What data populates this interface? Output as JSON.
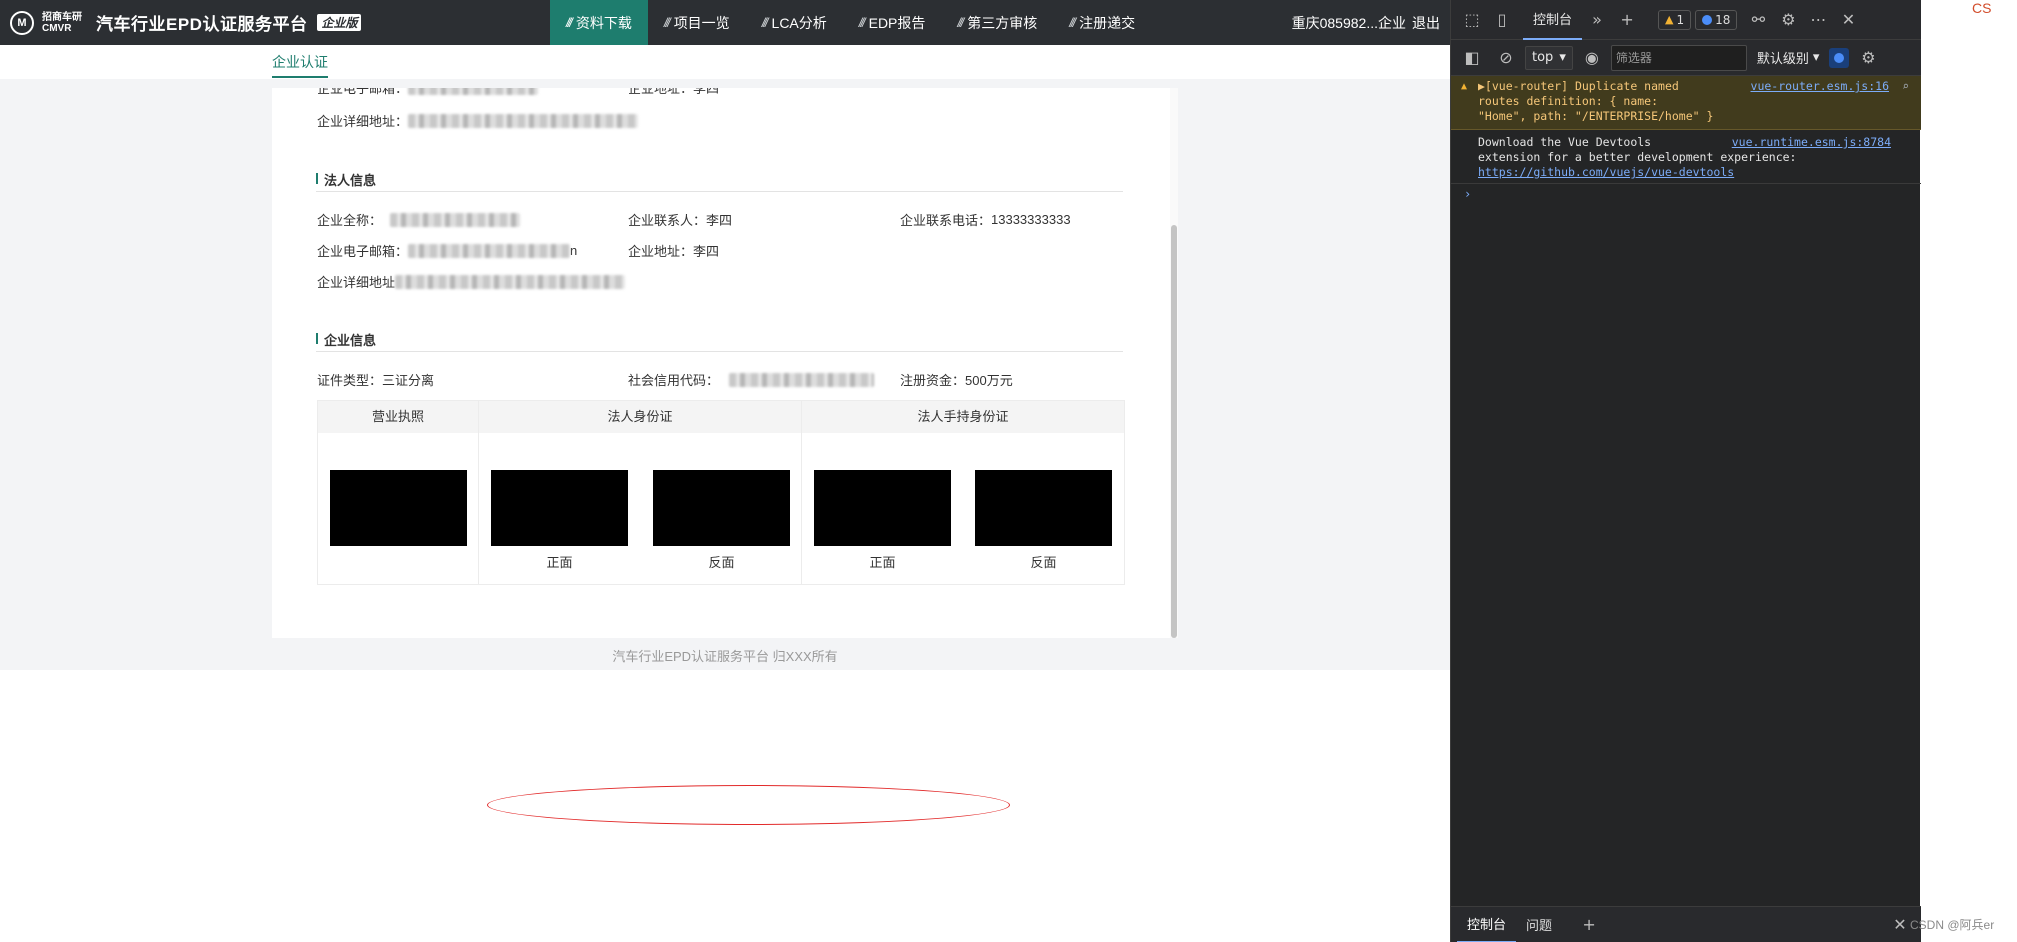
{
  "app": {
    "brand": {
      "logo_cn": "招商车研",
      "logo_en": "CMVR",
      "title": "汽车行业EPD认证服务平台",
      "badge": "企业版"
    },
    "nav": [
      {
        "label": "资料下载",
        "active": true
      },
      {
        "label": "项目一览",
        "active": false
      },
      {
        "label": "LCA分析",
        "active": false
      },
      {
        "label": "EDP报告",
        "active": false
      },
      {
        "label": "第三方审核",
        "active": false
      },
      {
        "label": "注册递交",
        "active": false
      }
    ],
    "user": {
      "name": "重庆085982...企业",
      "logout": "退出"
    },
    "subnav": {
      "tab": "企业认证"
    },
    "top_partial": {
      "email_label": "企业电子邮箱：",
      "addr_label": "企业地址：",
      "addr_value": "李四",
      "detail_label": "企业详细地址："
    },
    "legal": {
      "title": "法人信息",
      "fullname_label": "企业全称：",
      "contact_label": "企业联系人：",
      "contact_value": "李四",
      "phone_label": "企业联系电话：",
      "phone_value": "13333333333",
      "email_label": "企业电子邮箱：",
      "email_suffix": "n",
      "addr_label": "企业地址：",
      "addr_value": "李四",
      "detail_label": "企业详细地址"
    },
    "company": {
      "title": "企业信息",
      "cert_type_label": "证件类型：",
      "cert_type_value": "三证分离",
      "credit_code_label": "社会信用代码：",
      "capital_label": "注册资金：",
      "capital_value": "500万元"
    },
    "documents": {
      "col_license": "营业执照",
      "col_idcard": "法人身份证",
      "col_handheld": "法人手持身份证",
      "front": "正面",
      "back": "反面"
    },
    "footer": "汽车行业EPD认证服务平台 归XXX所有"
  },
  "devtools": {
    "tab_console": "控制台",
    "warn_count": "1",
    "msg_count": "18",
    "context": "top",
    "filter_placeholder": "筛选器",
    "levels": "默认级别",
    "messages": [
      {
        "type": "warning",
        "text": "[vue-router] Duplicate named routes definition: { name: \"Home\", path: \"/ENTERPRISE/home\" }",
        "line1": "[vue-router] Duplicate named",
        "line2": "routes definition: { name:",
        "line3": "\"Home\", path: \"/ENTERPRISE/home\" }",
        "source": "vue-router.esm.js:16"
      },
      {
        "type": "info",
        "line1": "Download the Vue Devtools",
        "line2": "extension for a better development experience:",
        "link": "https://github.com/vuejs/vue-devtools",
        "source": "vue.runtime.esm.js:8784"
      }
    ],
    "drawer": {
      "tab_console": "控制台",
      "tab_issues": "问题"
    }
  },
  "watermark": "CSDN @阿兵er",
  "corner_text": "CS"
}
